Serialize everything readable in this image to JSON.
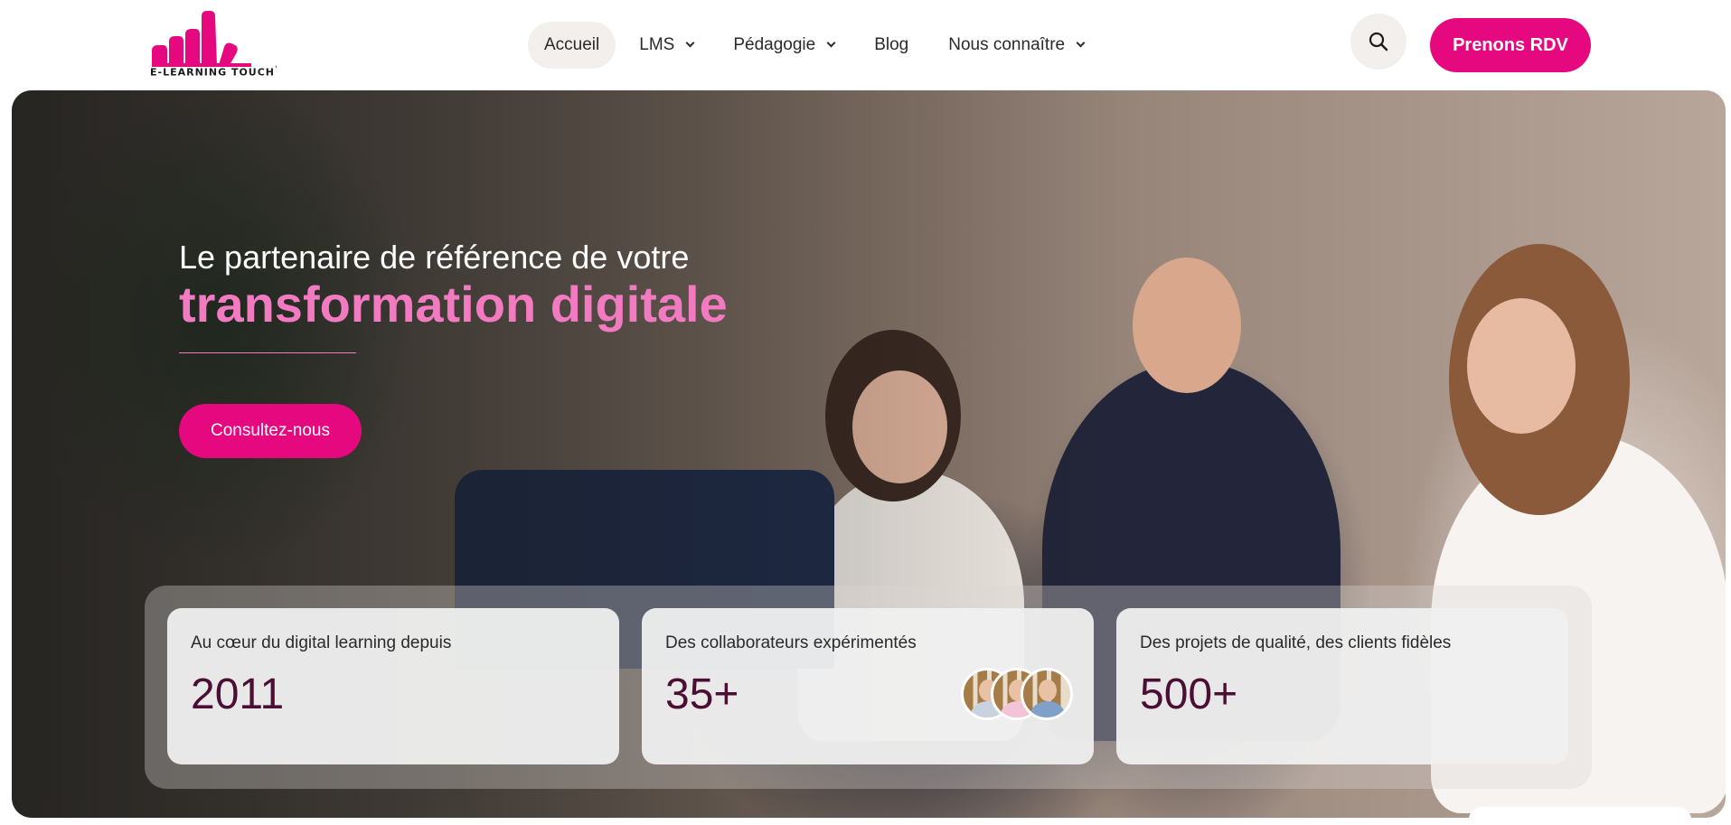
{
  "header": {
    "logo_text": "E-LEARNING TOUCH",
    "logo_mark": "'",
    "nav": [
      {
        "label": "Accueil"
      },
      {
        "label": "LMS"
      },
      {
        "label": "Pédagogie"
      },
      {
        "label": "Blog"
      },
      {
        "label": "Nous connaître"
      }
    ],
    "search_icon": "search-icon",
    "cta_label": "Prenons RDV"
  },
  "hero": {
    "line1": "Le partenaire de référence de votre",
    "line2": "transformation digitale",
    "cta_label": "Consultez-nous"
  },
  "stats": [
    {
      "label": "Au cœur du digital learning depuis",
      "value": "2011"
    },
    {
      "label": "Des collaborateurs expérimentés",
      "value": "35+"
    },
    {
      "label": "Des projets de qualité, des clients fidèles",
      "value": "500+"
    }
  ],
  "colors": {
    "brand_pink": "#e5087e",
    "accent_pink": "#f27ac0",
    "stat_value": "#4a0f33"
  }
}
